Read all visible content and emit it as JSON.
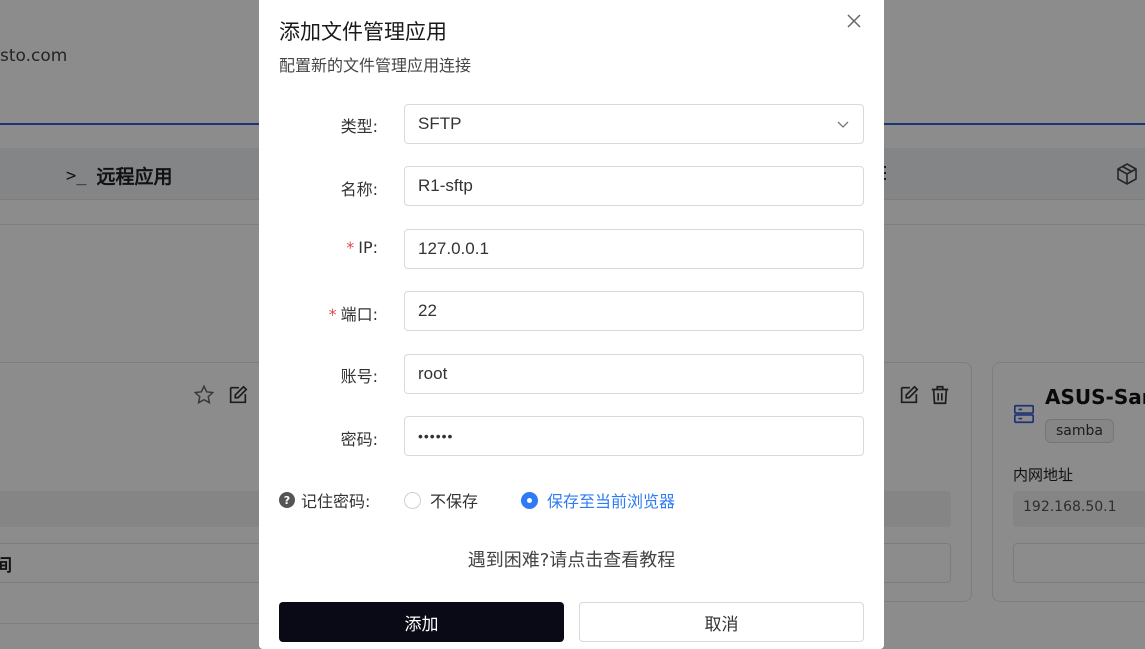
{
  "background": {
    "domain_fragment": "sto.com",
    "tab_remote_label": "远程应用",
    "left_card_fragment": "间",
    "right_card": {
      "title": "ASUS-Sam",
      "tag": "samba",
      "lan_label": "内网地址",
      "lan_ip": "192.168.50.1"
    }
  },
  "modal": {
    "title": "添加文件管理应用",
    "subtitle": "配置新的文件管理应用连接",
    "fields": {
      "type": {
        "label": "类型:",
        "value": "SFTP"
      },
      "name": {
        "label": "名称:",
        "value": "R1-sftp"
      },
      "ip": {
        "required_mark": "*",
        "label": "IP:",
        "value": "127.0.0.1"
      },
      "port": {
        "required_mark": "*",
        "label": "端口:",
        "value": "22"
      },
      "account": {
        "label": "账号:",
        "value": "root"
      },
      "password": {
        "label": "密码:",
        "value": "••••••"
      }
    },
    "remember": {
      "label": "记住密码:",
      "help_glyph": "?",
      "options": [
        {
          "label": "不保存",
          "checked": false
        },
        {
          "label": "保存至当前浏览器",
          "checked": true
        }
      ]
    },
    "help_link": "遇到困难?请点击查看教程",
    "buttons": {
      "add": "添加",
      "cancel": "取消"
    }
  },
  "colors": {
    "accent": "#2f7bf5",
    "primary_button": "#090a16",
    "required": "#e5484d",
    "nav_line": "#2f62d8"
  }
}
